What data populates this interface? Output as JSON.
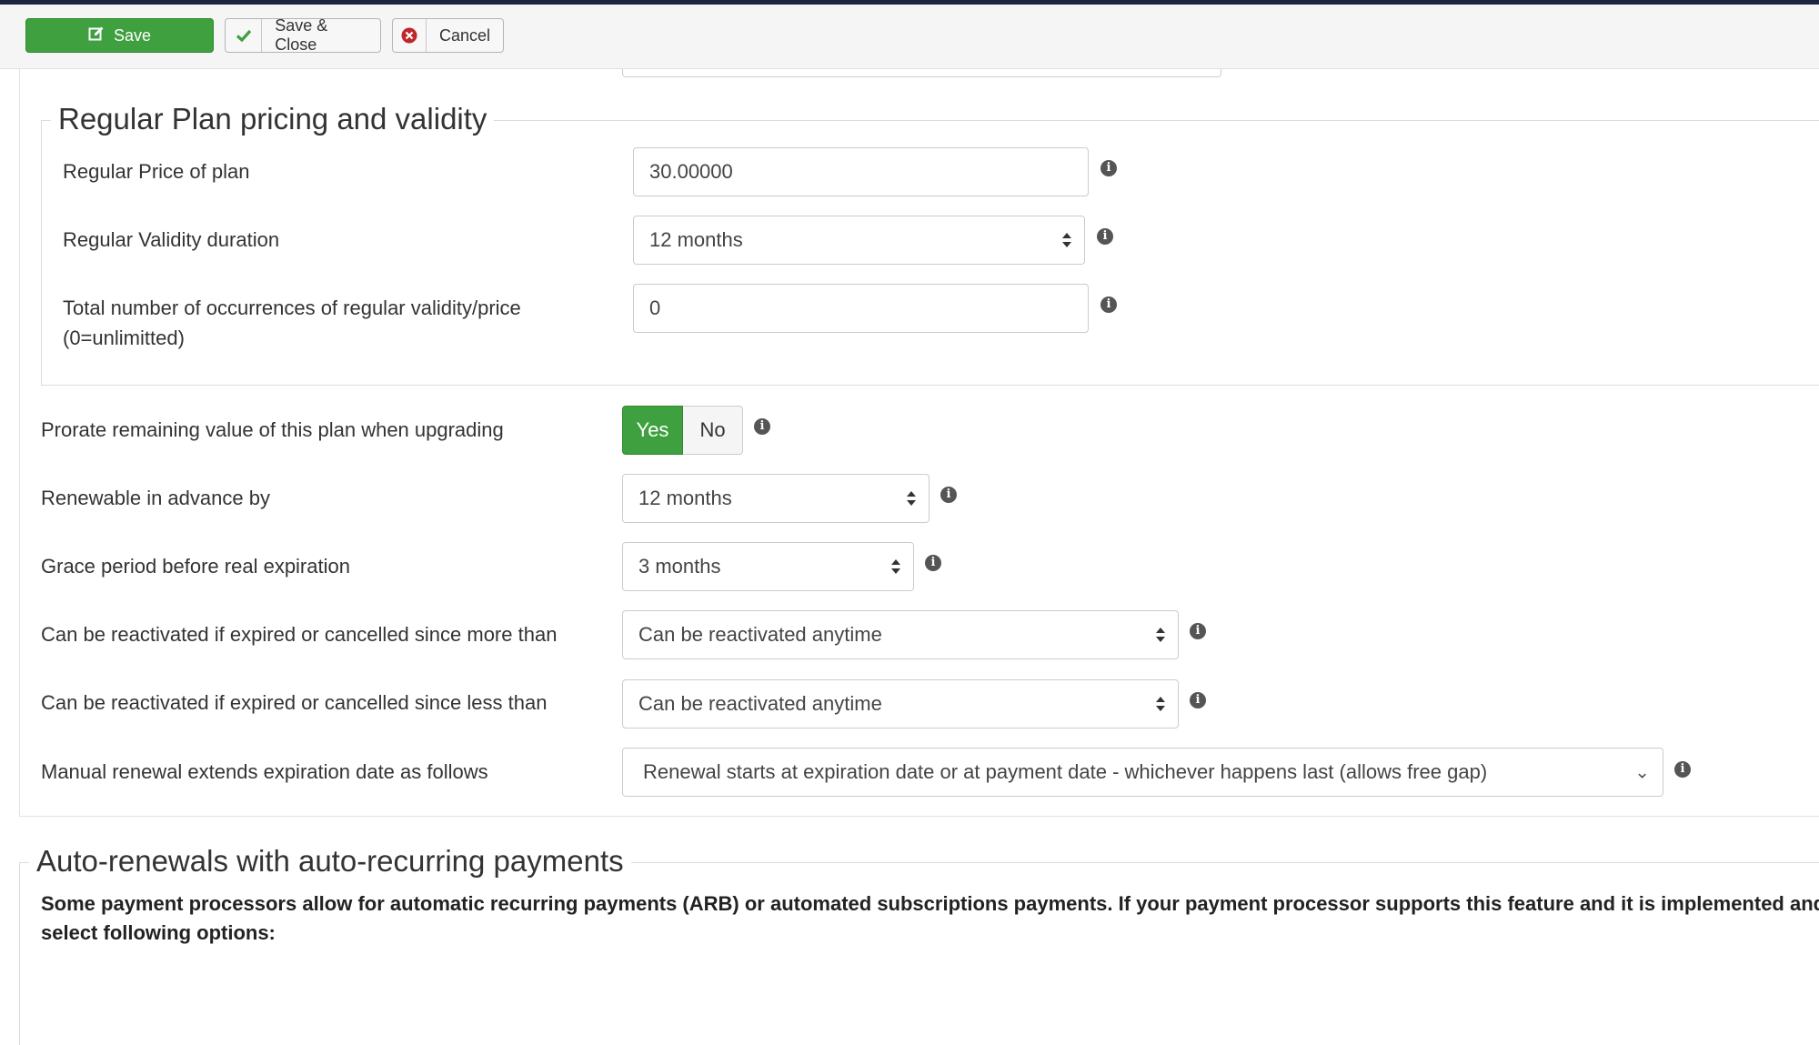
{
  "toolbar": {
    "save_label": "Save",
    "save_close_label": "Save & Close",
    "cancel_label": "Cancel",
    "save_icon": "edit-icon",
    "save_close_icon": "check-icon",
    "cancel_icon": "cancel-circle-icon"
  },
  "regular": {
    "legend": "Regular Plan pricing and validity",
    "price_label": "Regular Price of plan",
    "price_value": "30.00000",
    "validity_label": "Regular Validity duration",
    "validity_value": "12 months",
    "occurrences_label_line1": "Total number of occurrences of regular validity/price",
    "occurrences_label_line2": "(0=unlimitted)",
    "occurrences_value": "0"
  },
  "options": {
    "prorate_label": "Prorate remaining value of this plan when upgrading",
    "prorate_yes": "Yes",
    "prorate_no": "No",
    "prorate_selected": "Yes",
    "renewable_label": "Renewable in advance by",
    "renewable_value": "12 months",
    "grace_label": "Grace period before real expiration",
    "grace_value": "3 months",
    "reactivate_more_label": "Can be reactivated if expired or cancelled since more than",
    "reactivate_more_value": "Can be reactivated anytime",
    "reactivate_less_label": "Can be reactivated if expired or cancelled since less than",
    "reactivate_less_value": "Can be reactivated anytime",
    "manual_renewal_label": "Manual renewal extends expiration date as follows",
    "manual_renewal_value": "Renewal starts at expiration date or at payment date - whichever happens last (allows free gap)"
  },
  "auto": {
    "legend": "Auto-renewals with auto-recurring payments",
    "description_line1": "Some payment processors allow for automatic recurring payments (ARB) or automated subscriptions payments. If your payment processor supports this feature and it is implemented and",
    "description_line2": "select following options:"
  },
  "colors": {
    "success_green": "#3ea03e",
    "top_bar": "#1b2640",
    "info_icon": "#555555",
    "cancel_red": "#c0272d"
  }
}
